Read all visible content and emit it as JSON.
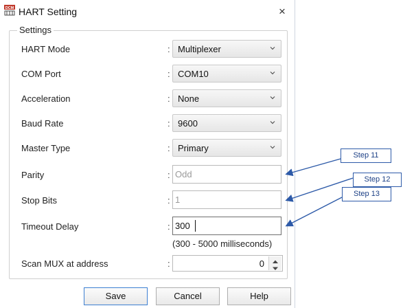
{
  "window": {
    "title": "HART Setting",
    "icon": "dcm-app-icon",
    "close_label": "×"
  },
  "settings": {
    "group_label": "Settings",
    "colon": ":",
    "hart_mode": {
      "label": "HART Mode",
      "value": "Multiplexer"
    },
    "com_port": {
      "label": "COM Port",
      "value": "COM10"
    },
    "acceleration": {
      "label": "Acceleration",
      "value": "None"
    },
    "baud_rate": {
      "label": "Baud Rate",
      "value": "9600"
    },
    "master_type": {
      "label": "Master Type",
      "value": "Primary"
    },
    "parity": {
      "label": "Parity",
      "value": "Odd"
    },
    "stop_bits": {
      "label": "Stop Bits",
      "value": "1"
    },
    "timeout_delay": {
      "label": "Timeout Delay",
      "value": "300",
      "hint": "(300 - 5000 milliseconds)"
    },
    "scan_mux": {
      "label": "Scan MUX at address",
      "value": "0"
    }
  },
  "buttons": {
    "save": "Save",
    "cancel": "Cancel",
    "help": "Help"
  },
  "annotations": {
    "step11": "Step 11",
    "step12": "Step 12",
    "step13": "Step 13",
    "arrow_color": "#2d5aa8"
  },
  "colors": {
    "primary_button_border": "#3c7fd2",
    "callout_border": "#2d5aa8"
  }
}
